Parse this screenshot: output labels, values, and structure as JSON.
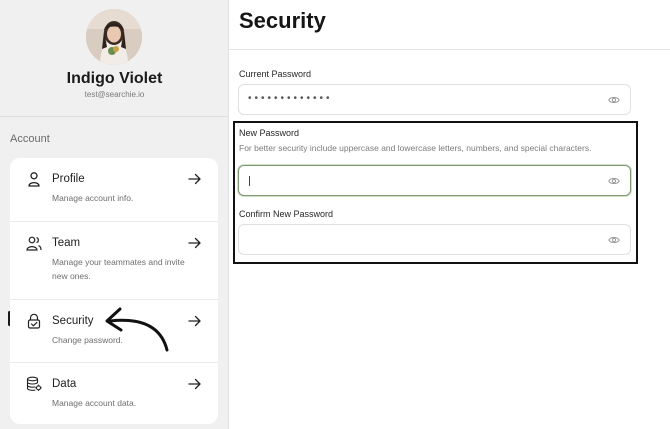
{
  "user": {
    "name": "Indigo Violet",
    "email": "test@searchie.io"
  },
  "sidebar": {
    "section_label": "Account",
    "active_item": "Security",
    "items": [
      {
        "label": "Profile",
        "description": "Manage account info.",
        "icon": "person-icon"
      },
      {
        "label": "Team",
        "description": "Manage your teammates and invite new ones.",
        "icon": "users-icon"
      },
      {
        "label": "Security",
        "description": "Change password.",
        "icon": "lock-check-icon"
      },
      {
        "label": "Data",
        "description": "Manage account data.",
        "icon": "database-icon"
      }
    ]
  },
  "main": {
    "title": "Security",
    "current_password": {
      "label": "Current Password",
      "value": "•••••••••••••"
    },
    "new_password": {
      "label": "New Password",
      "hint": "For better security include uppercase and lowercase letters, numbers, and special characters.",
      "value": ""
    },
    "confirm_password": {
      "label": "Confirm New Password",
      "value": ""
    }
  },
  "colors": {
    "sidebar_bg": "#f0f0f0",
    "focus_border": "#7d9a72",
    "annotation": "#111111"
  }
}
